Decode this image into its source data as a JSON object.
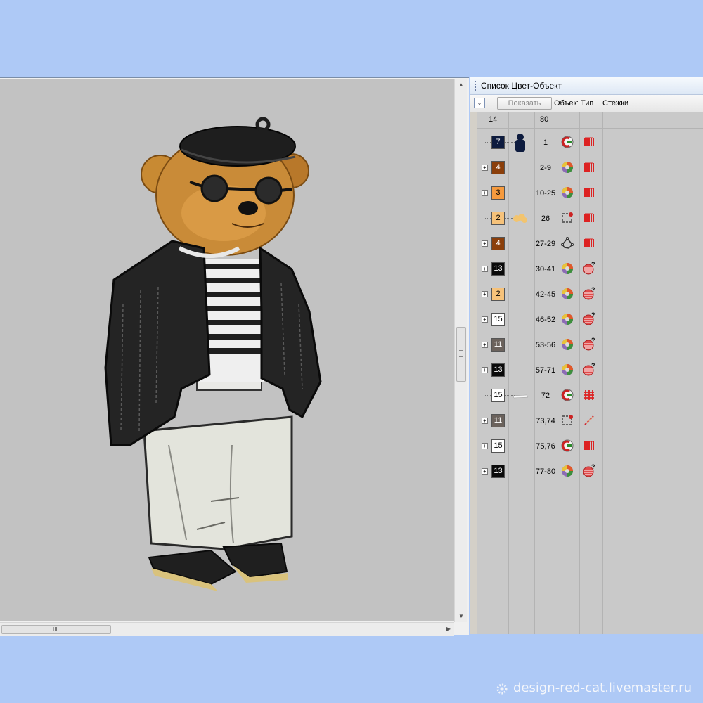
{
  "panel": {
    "title": "Список Цвет-Объект",
    "show_button": "Показать",
    "columns": {
      "object": "Объект",
      "type": "Тип",
      "stitches": "Стежки"
    },
    "total_colors": "14",
    "total_objects": "80"
  },
  "rows": [
    {
      "color_number": "7",
      "swatch_color": "#0d1b3e",
      "text_color": "#ffffff",
      "objects": "1",
      "expandable": false,
      "preview": "navy-figure",
      "object_icon": "appliqué-icon",
      "type_icon": "satin-icon"
    },
    {
      "color_number": "4",
      "swatch_color": "#8b3f0b",
      "text_color": "#ffffff",
      "objects": "2-9",
      "expandable": true,
      "preview": "",
      "object_icon": "color-wheel-icon",
      "type_icon": "satin-icon"
    },
    {
      "color_number": "3",
      "swatch_color": "#f59a3e",
      "text_color": "#000000",
      "objects": "10-25",
      "expandable": true,
      "preview": "",
      "object_icon": "color-wheel-icon",
      "type_icon": "satin-icon"
    },
    {
      "color_number": "2",
      "swatch_color": "#f6c27a",
      "text_color": "#000000",
      "objects": "26",
      "expandable": false,
      "preview": "tan-blob",
      "object_icon": "square-stitch-icon",
      "type_icon": "satin-icon"
    },
    {
      "color_number": "4",
      "swatch_color": "#8b3f0b",
      "text_color": "#ffffff",
      "objects": "27-29",
      "expandable": true,
      "preview": "",
      "object_icon": "shape-outline-icon",
      "type_icon": "satin-icon"
    },
    {
      "color_number": "13",
      "swatch_color": "#0a0a0a",
      "text_color": "#ffffff",
      "objects": "30-41",
      "expandable": true,
      "preview": "",
      "object_icon": "color-wheel-icon",
      "type_icon": "mixed-fill-icon"
    },
    {
      "color_number": "2",
      "swatch_color": "#f6c27a",
      "text_color": "#000000",
      "objects": "42-45",
      "expandable": true,
      "preview": "",
      "object_icon": "color-wheel-icon",
      "type_icon": "mixed-fill-icon"
    },
    {
      "color_number": "15",
      "swatch_color": "#ffffff",
      "text_color": "#000000",
      "objects": "46-52",
      "expandable": true,
      "preview": "",
      "object_icon": "color-wheel-icon",
      "type_icon": "mixed-fill-icon"
    },
    {
      "color_number": "11",
      "swatch_color": "#6b625c",
      "text_color": "#ffffff",
      "objects": "53-56",
      "expandable": true,
      "preview": "",
      "object_icon": "color-wheel-icon",
      "type_icon": "mixed-fill-icon"
    },
    {
      "color_number": "13",
      "swatch_color": "#0a0a0a",
      "text_color": "#ffffff",
      "objects": "57-71",
      "expandable": true,
      "preview": "",
      "object_icon": "color-wheel-icon",
      "type_icon": "mixed-fill-icon"
    },
    {
      "color_number": "15",
      "swatch_color": "#ffffff",
      "text_color": "#000000",
      "objects": "72",
      "expandable": false,
      "preview": "white-strip",
      "object_icon": "appliqué-icon",
      "type_icon": "tatami-icon"
    },
    {
      "color_number": "11",
      "swatch_color": "#6b625c",
      "text_color": "#ffffff",
      "objects": "73,74",
      "expandable": true,
      "preview": "",
      "object_icon": "square-stitch-icon",
      "type_icon": "running-stitch-icon"
    },
    {
      "color_number": "15",
      "swatch_color": "#ffffff",
      "text_color": "#000000",
      "objects": "75,76",
      "expandable": true,
      "preview": "",
      "object_icon": "appliqué-icon",
      "type_icon": "satin-icon"
    },
    {
      "color_number": "13",
      "swatch_color": "#0a0a0a",
      "text_color": "#ffffff",
      "objects": "77-80",
      "expandable": true,
      "preview": "",
      "object_icon": "color-wheel-icon",
      "type_icon": "mixed-fill-icon"
    }
  ],
  "watermark": "design-red-cat.livemaster.ru"
}
